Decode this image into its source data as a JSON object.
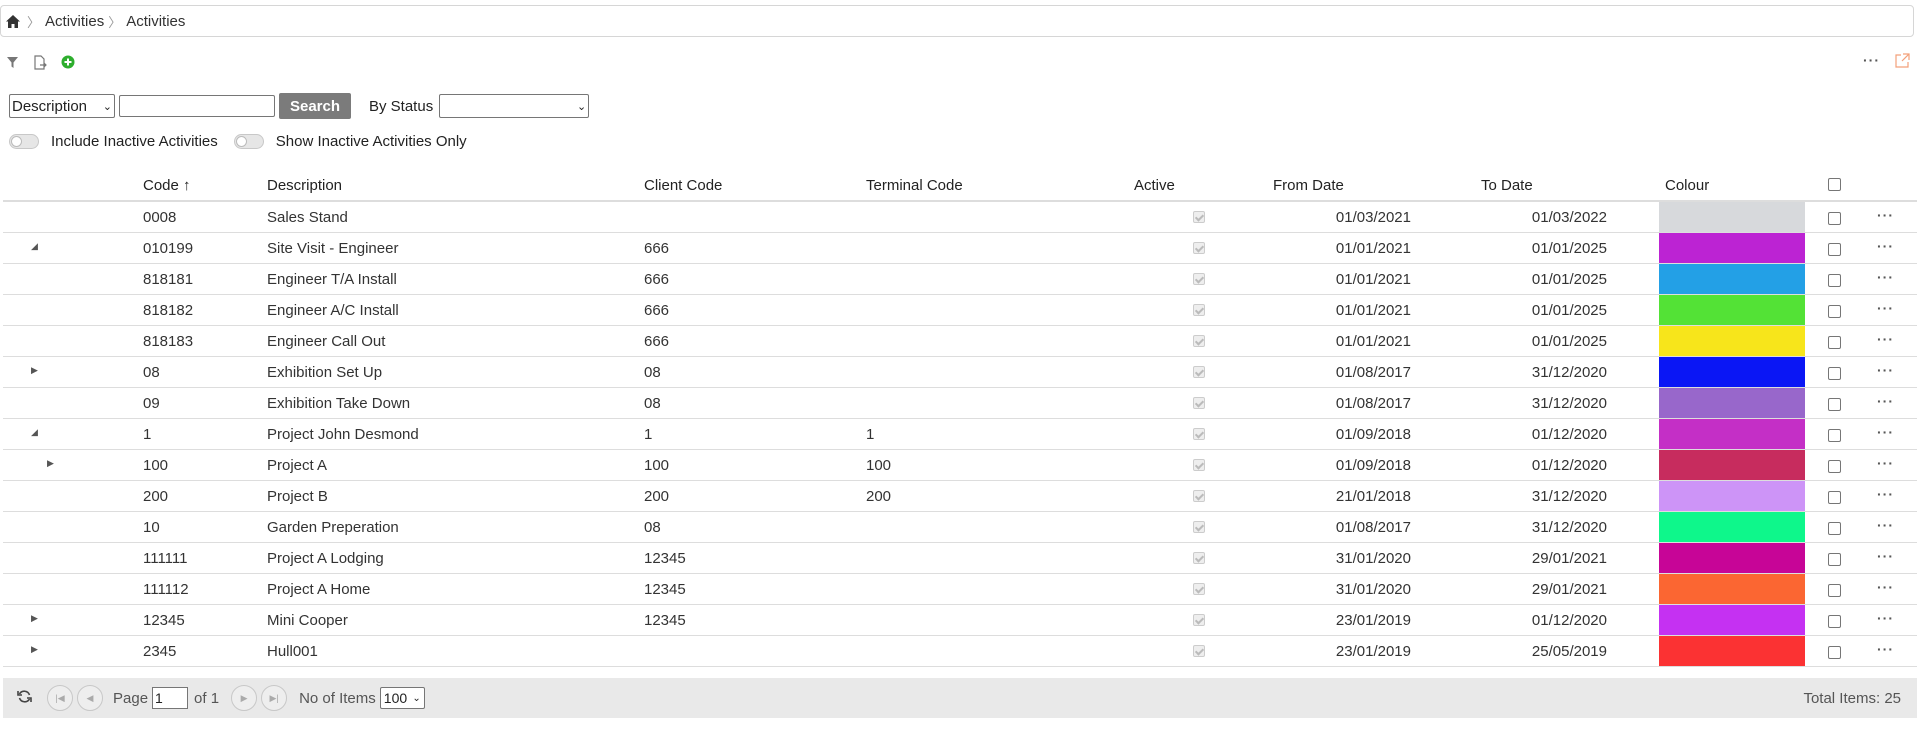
{
  "breadcrumb": [
    "Activities",
    "Activities"
  ],
  "search": {
    "field_selected": "Description",
    "value": "",
    "button": "Search",
    "status_label": "By Status",
    "status_selected": ""
  },
  "toggles": {
    "include_inactive": "Include Inactive Activities",
    "inactive_only": "Show Inactive Activities Only"
  },
  "columns": {
    "code": "Code",
    "sort_indicator": "↑",
    "description": "Description",
    "client_code": "Client Code",
    "terminal_code": "Terminal Code",
    "active": "Active",
    "from_date": "From Date",
    "to_date": "To Date",
    "colour": "Colour"
  },
  "rows": [
    {
      "expander": "",
      "code": "0008",
      "description": "Sales Stand",
      "client_code": "",
      "terminal_code": "",
      "from": "01/03/2021",
      "to": "01/03/2022",
      "colour": "#d7d9dc"
    },
    {
      "expander": "collapse",
      "code": "010199",
      "description": "Site Visit - Engineer",
      "client_code": "666",
      "terminal_code": "",
      "from": "01/01/2021",
      "to": "01/01/2025",
      "colour": "#bc23d3"
    },
    {
      "expander": "",
      "code": "818181",
      "description": "Engineer T/A Install",
      "client_code": "666",
      "terminal_code": "",
      "from": "01/01/2021",
      "to": "01/01/2025",
      "colour": "#23a0e6"
    },
    {
      "expander": "",
      "code": "818182",
      "description": "Engineer A/C Install",
      "client_code": "666",
      "terminal_code": "",
      "from": "01/01/2021",
      "to": "01/01/2025",
      "colour": "#53e236"
    },
    {
      "expander": "",
      "code": "818183",
      "description": "Engineer Call Out",
      "client_code": "666",
      "terminal_code": "",
      "from": "01/01/2021",
      "to": "01/01/2025",
      "colour": "#f7e51b"
    },
    {
      "expander": "expand",
      "code": "08",
      "description": "Exhibition Set Up",
      "client_code": "08",
      "terminal_code": "",
      "from": "01/08/2017",
      "to": "31/12/2020",
      "colour": "#0a16f5"
    },
    {
      "expander": "",
      "code": "09",
      "description": "Exhibition Take Down",
      "client_code": "08",
      "terminal_code": "",
      "from": "01/08/2017",
      "to": "31/12/2020",
      "colour": "#9867cb"
    },
    {
      "expander": "collapse",
      "code": "1",
      "description": "Project John Desmond",
      "client_code": "1",
      "terminal_code": "1",
      "from": "01/09/2018",
      "to": "01/12/2020",
      "colour": "#c42fc6"
    },
    {
      "expander": "expand-l2",
      "code": "100",
      "description": "Project A",
      "client_code": "100",
      "terminal_code": "100",
      "from": "01/09/2018",
      "to": "01/12/2020",
      "colour": "#c72c5e"
    },
    {
      "expander": "",
      "code": "200",
      "description": "Project B",
      "client_code": "200",
      "terminal_code": "200",
      "from": "21/01/2018",
      "to": "31/12/2020",
      "colour": "#cd94f7"
    },
    {
      "expander": "",
      "code": "10",
      "description": "Garden Preperation",
      "client_code": "08",
      "terminal_code": "",
      "from": "01/08/2017",
      "to": "31/12/2020",
      "colour": "#0ef78b"
    },
    {
      "expander": "",
      "code": "111111",
      "description": "Project A Lodging",
      "client_code": "12345",
      "terminal_code": "",
      "from": "31/01/2020",
      "to": "29/01/2021",
      "colour": "#c70597"
    },
    {
      "expander": "",
      "code": "111112",
      "description": "Project A Home",
      "client_code": "12345",
      "terminal_code": "",
      "from": "31/01/2020",
      "to": "29/01/2021",
      "colour": "#fb6632"
    },
    {
      "expander": "expand",
      "code": "12345",
      "description": "Mini Cooper",
      "client_code": "12345",
      "terminal_code": "",
      "from": "23/01/2019",
      "to": "01/12/2020",
      "colour": "#c531f2"
    },
    {
      "expander": "expand",
      "code": "2345",
      "description": "Hull001",
      "client_code": "",
      "terminal_code": "",
      "from": "23/01/2019",
      "to": "25/05/2019",
      "colour": "#fb3233"
    }
  ],
  "pager": {
    "page_label": "Page",
    "page_value": "1",
    "of_label": "of 1",
    "items_label": "No of Items",
    "page_size": "100",
    "total": "Total Items: 25"
  },
  "icons": {
    "home": "home-icon",
    "filter": "filter-icon",
    "export": "export-icon",
    "add": "add-icon",
    "open": "open-external-icon",
    "refresh": "refresh-icon"
  },
  "accent_colors": {
    "add": "#2eae2e",
    "open": "#f3a07a",
    "search_button": "#7b7b7b"
  }
}
